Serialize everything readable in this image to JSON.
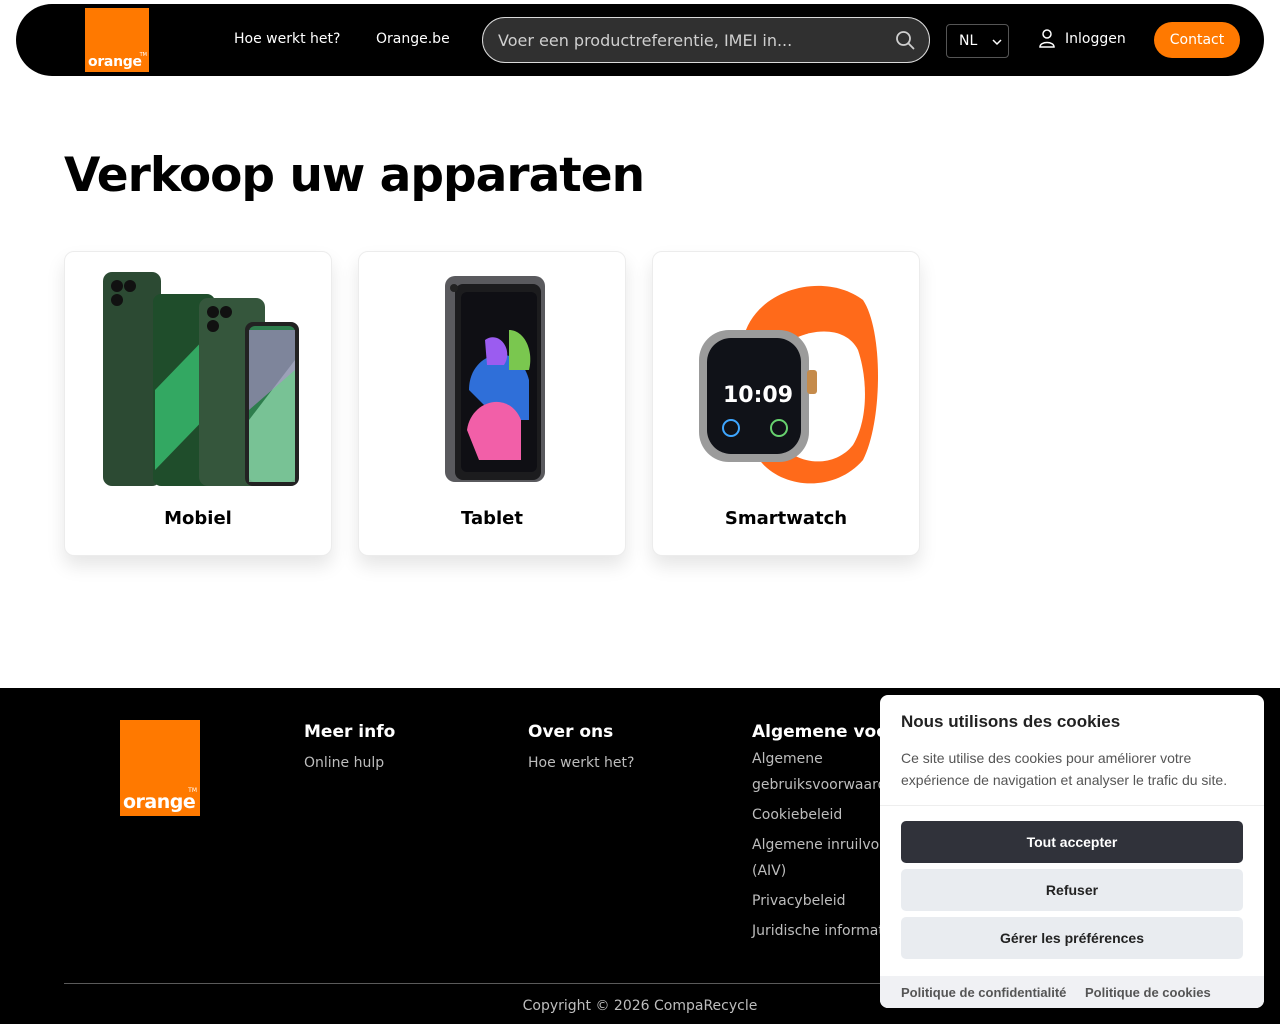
{
  "header": {
    "logo": "orange",
    "nav": [
      "Hoe werkt het?",
      "Orange.be"
    ],
    "search_placeholder": "Voer een productreferentie, IMEI in...",
    "language": "NL",
    "login": "Inloggen",
    "contact": "Contact"
  },
  "main": {
    "title": "Verkoop uw apparaten",
    "cards": [
      {
        "label": "Mobiel"
      },
      {
        "label": "Tablet"
      },
      {
        "label": "Smartwatch"
      }
    ]
  },
  "footer": {
    "logo": "orange",
    "columns": [
      {
        "heading": "Meer info",
        "links": [
          "Online hulp"
        ]
      },
      {
        "heading": "Over ons",
        "links": [
          "Hoe werkt het?"
        ]
      },
      {
        "heading": "Algemene voorw",
        "links": [
          "Algemene gebruiksvoorwaarden",
          "Cookiebeleid",
          "Algemene inruilvo (AIV)",
          "Privacybeleid",
          "Juridische informat"
        ]
      }
    ],
    "copyright": "Copyright © 2026 CompaRecycle"
  },
  "cookie": {
    "title": "Nous utilisons des cookies",
    "text": "Ce site utilise des cookies pour améliorer votre expérience de navigation et analyser le trafic du site.",
    "accept": "Tout accepter",
    "refuse": "Refuser",
    "preferences": "Gérer les préférences",
    "privacy_link": "Politique de confidentialité",
    "cookie_link": "Politique de cookies"
  },
  "colors": {
    "brand": "#ff7900",
    "dark": "#000000",
    "cookie_button": "#30323a"
  }
}
